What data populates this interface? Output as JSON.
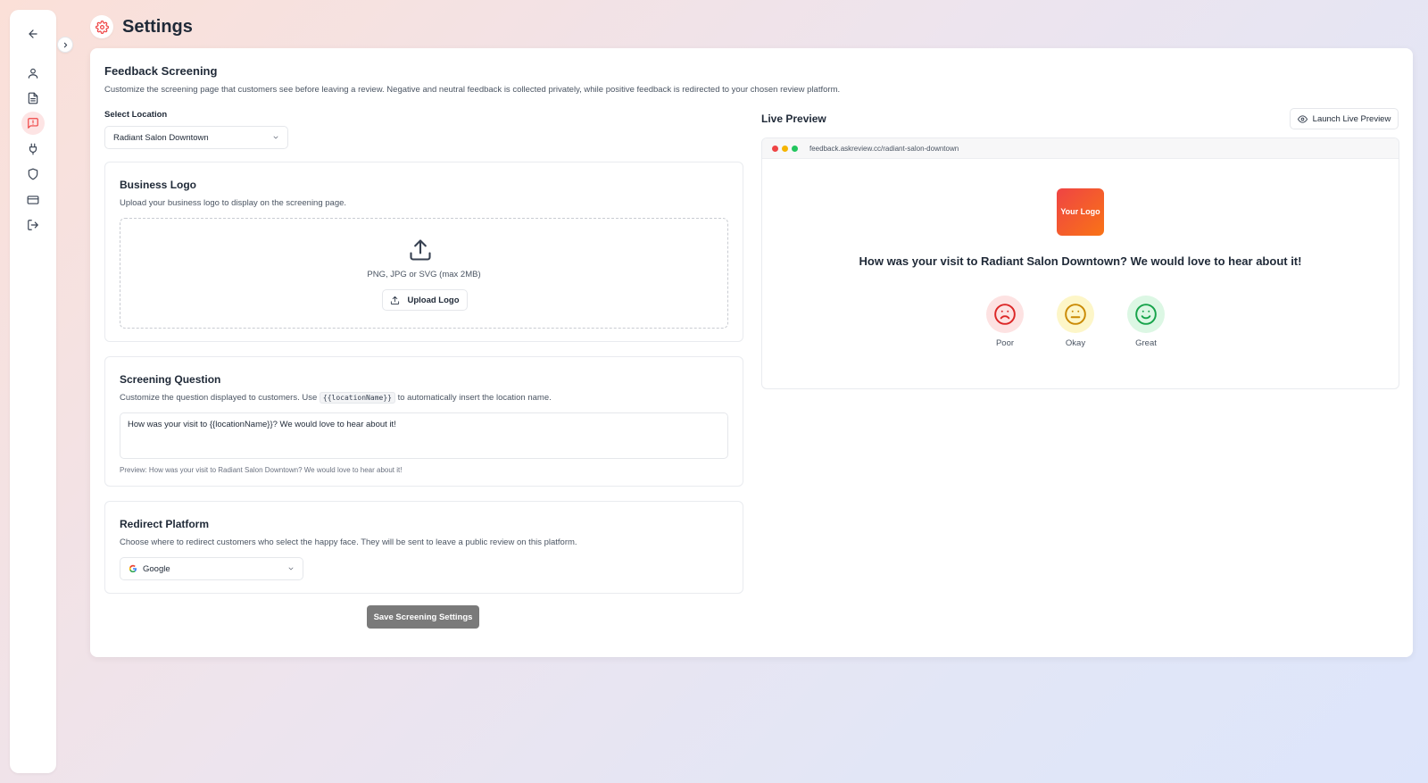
{
  "colors": {
    "accent": "#ef4444",
    "save_button_bg": "#7a7a7a",
    "poor_bg": "#fde2e2",
    "okay_bg": "#fdf6c8",
    "great_bg": "#dcf7e4"
  },
  "sidebar": {
    "items": [
      {
        "icon": "arrow-left-icon"
      },
      {
        "icon": "user-icon"
      },
      {
        "icon": "document-icon"
      },
      {
        "icon": "message-alert-icon",
        "active": true
      },
      {
        "icon": "plug-icon"
      },
      {
        "icon": "shield-icon"
      },
      {
        "icon": "credit-card-icon"
      },
      {
        "icon": "logout-icon"
      }
    ]
  },
  "header": {
    "title": "Settings",
    "icon": "gear-icon"
  },
  "screening": {
    "title": "Feedback Screening",
    "description": "Customize the screening page that customers see before leaving a review. Negative and neutral feedback is collected privately, while positive feedback is redirected to your chosen review platform.",
    "location": {
      "label": "Select Location",
      "value": "Radiant Salon Downtown"
    }
  },
  "logo_panel": {
    "title": "Business Logo",
    "description": "Upload your business logo to display on the screening page.",
    "formats": "PNG, JPG or SVG (max 2MB)",
    "upload_label": "Upload Logo"
  },
  "question_panel": {
    "title": "Screening Question",
    "desc_prefix": "Customize the question displayed to customers. Use",
    "desc_code": "{{locationName}}",
    "desc_suffix": "to automatically insert the location name.",
    "value": "How was your visit to {{locationName}}? We would love to hear about it!",
    "preview": "Preview: How was your visit to Radiant Salon Downtown? We would love to hear about it!"
  },
  "redirect_panel": {
    "title": "Redirect Platform",
    "description": "Choose where to redirect customers who select the happy face. They will be sent to leave a public review on this platform.",
    "platform": "Google"
  },
  "save_label": "Save Screening Settings",
  "live_preview": {
    "title": "Live Preview",
    "launch_label": "Launch Live Preview",
    "url": "feedback.askreview.cc/radiant-salon-downtown",
    "logo_text": "Your Logo",
    "question": "How was your visit to Radiant Salon Downtown? We would love to hear about it!",
    "options": [
      {
        "label": "Poor",
        "icon": "frown-face-icon"
      },
      {
        "label": "Okay",
        "icon": "neutral-face-icon"
      },
      {
        "label": "Great",
        "icon": "smile-face-icon"
      }
    ]
  }
}
